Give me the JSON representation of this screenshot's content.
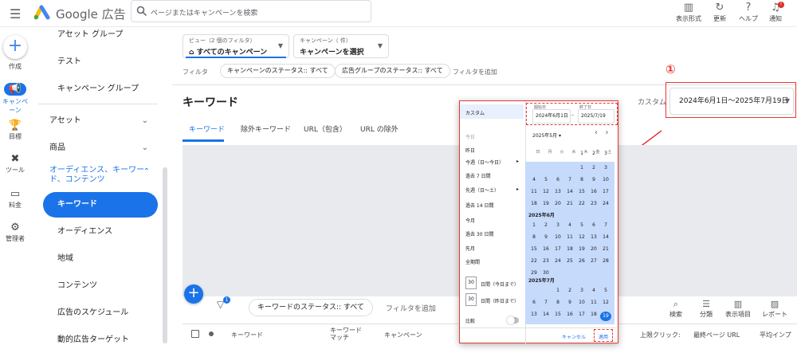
{
  "header": {
    "brand": "Google 広告",
    "search_placeholder": "ページまたはキャンペーンを検索",
    "tools": [
      {
        "icon": "bar-chart-icon",
        "label": "表示形式"
      },
      {
        "icon": "refresh-icon",
        "label": "更新"
      },
      {
        "icon": "help-icon",
        "label": "ヘルプ"
      },
      {
        "icon": "bell-icon",
        "label": "通知"
      }
    ]
  },
  "rail": {
    "create": "作成",
    "campaign": "キャンペーン",
    "goals": "目標",
    "tools": "ツール",
    "billing": "料金",
    "admin": "管理者"
  },
  "nav": {
    "items": [
      "アセット グループ",
      "テスト",
      "キャンペーン グループ",
      "アセット",
      "商品",
      "オーディエンス、キーワード、コンテンツ",
      "キーワード",
      "オーディエンス",
      "地域",
      "コンテンツ",
      "広告のスケジュール",
      "動的広告ターゲット"
    ]
  },
  "view": {
    "label": "ビュー（2 個のフィルタ）",
    "value": "すべてのキャンペーン"
  },
  "campaign_select": {
    "label": "キャンペーン（ 件）",
    "value": "キャンペーンを選択"
  },
  "filters": {
    "label": "フィルタ",
    "chips": [
      "キャンペーンのステータス:: すべて",
      "広告グループのステータス:: すべて"
    ],
    "add": "フィルタを追加"
  },
  "page_title": "キーワード",
  "tabs": [
    "キーワード",
    "除外キーワード",
    "URL（包含）",
    "URL の除外"
  ],
  "date": {
    "custom_label": "カスタム",
    "range": "2024年6月1日～2025年7月19日",
    "annotation": "①"
  },
  "table": {
    "status_chip": "キーワードのステータス:: すべて",
    "add_filter": "フィルタを追加",
    "headers": [
      "キーワード",
      "キーワード\nマッチ",
      "キャンペーン",
      "上限クリック:",
      "最終ページ URL",
      "平均インプ"
    ],
    "buttons": [
      "検索",
      "分類",
      "表示項目",
      "レポート"
    ]
  },
  "picker": {
    "custom": "カスタム",
    "presets": [
      "今日",
      "昨日",
      "今週（日～今日）",
      "過去 7 日間",
      "先週（日～土）",
      "過去 14 日間",
      "今月",
      "過去 30 日間",
      "先月",
      "全期間"
    ],
    "days1": "30",
    "days1_label": "日間（今日まで）",
    "days2": "30",
    "days2_label": "日間（昨日まで）",
    "compare": "比較",
    "start_label": "開始日",
    "end_label": "終了日",
    "start": "2024年6月1日",
    "end": "2025/7/19",
    "month_select": "2025年5月 ▾",
    "dow": [
      "日",
      "月",
      "火",
      "水",
      "木",
      "金",
      "土"
    ],
    "may": [
      [
        "",
        "",
        "",
        "",
        "1",
        "2",
        "3"
      ],
      [
        "4",
        "5",
        "6",
        "7",
        "8",
        "9",
        "10"
      ],
      [
        "11",
        "12",
        "13",
        "14",
        "15",
        "16",
        "17"
      ],
      [
        "18",
        "19",
        "20",
        "21",
        "22",
        "23",
        "24"
      ],
      [
        "25",
        "26",
        "27",
        "28",
        "29",
        "30",
        "31"
      ]
    ],
    "june_label": "2025年6月",
    "june": [
      [
        "1",
        "2",
        "3",
        "4",
        "5",
        "6",
        "7"
      ],
      [
        "8",
        "9",
        "10",
        "11",
        "12",
        "13",
        "14"
      ],
      [
        "15",
        "16",
        "17",
        "18",
        "19",
        "20",
        "21"
      ],
      [
        "22",
        "23",
        "24",
        "25",
        "26",
        "27",
        "28"
      ],
      [
        "29",
        "30",
        "",
        "",
        "",
        "",
        ""
      ]
    ],
    "july_label": "2025年7月",
    "july": [
      [
        "",
        "",
        "1",
        "2",
        "3",
        "4",
        "5"
      ],
      [
        "6",
        "7",
        "8",
        "9",
        "10",
        "11",
        "12"
      ],
      [
        "13",
        "14",
        "15",
        "16",
        "17",
        "18",
        "19"
      ]
    ],
    "cancel": "キャンセル",
    "apply": "適用"
  }
}
